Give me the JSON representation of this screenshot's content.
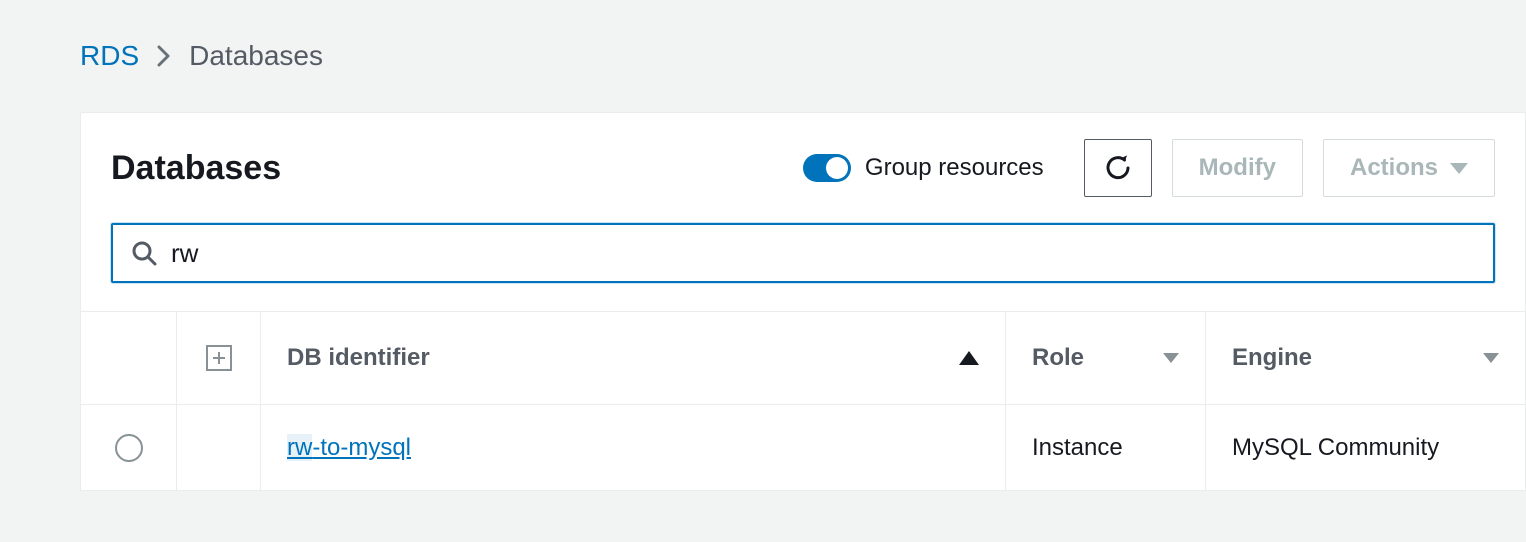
{
  "breadcrumb": {
    "root": "RDS",
    "current": "Databases"
  },
  "header": {
    "title": "Databases",
    "toggle_label": "Group resources",
    "toggle_on": true,
    "modify_label": "Modify",
    "actions_label": "Actions"
  },
  "search": {
    "value": "rw"
  },
  "table": {
    "columns": {
      "id": "DB identifier",
      "role": "Role",
      "engine": "Engine"
    },
    "rows": [
      {
        "id_match": "rw",
        "id_rest": "-to-mysql",
        "role": "Instance",
        "engine": "MySQL Community"
      }
    ]
  }
}
